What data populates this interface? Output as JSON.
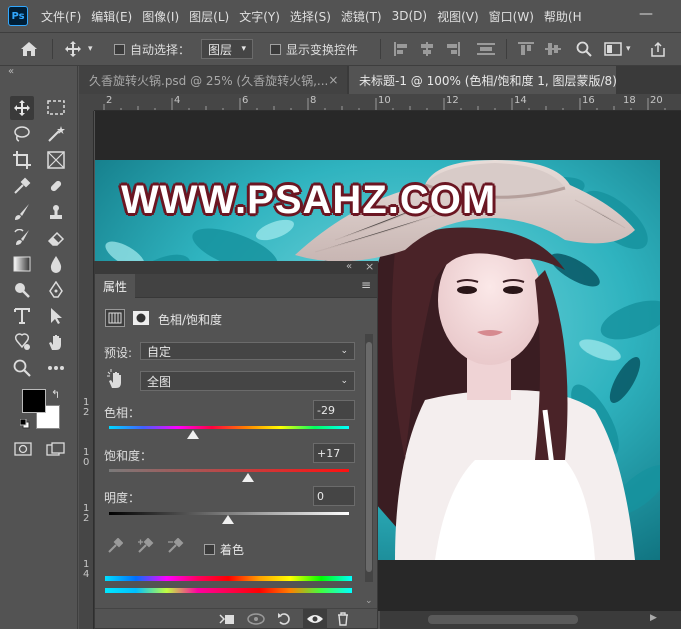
{
  "app": {
    "logo": "Ps"
  },
  "menu": [
    "文件(F)",
    "编辑(E)",
    "图像(I)",
    "图层(L)",
    "文字(Y)",
    "选择(S)",
    "滤镜(T)",
    "3D(D)",
    "视图(V)",
    "窗口(W)",
    "帮助(H"
  ],
  "options": {
    "auto_select_label": "自动选择：",
    "auto_select_target": "图层",
    "show_transform_label": "显示变换控件"
  },
  "tabs": [
    {
      "label": "久香旋转火锅.psd @ 25% (久香旋转火锅,...",
      "active": false
    },
    {
      "label": "未标题-1 @ 100% (色相/饱和度 1, 图层蒙版/8) *",
      "active": true
    }
  ],
  "ruler_top": [
    "2",
    "4",
    "6",
    "8",
    "10",
    "12",
    "14",
    "16",
    "18",
    "20"
  ],
  "ruler_left": [
    [
      "1",
      "2"
    ],
    [
      "1",
      "4"
    ],
    [
      "1",
      "6"
    ],
    [
      "1",
      "8"
    ],
    [
      "1",
      "0"
    ],
    [
      "1",
      "2"
    ],
    [
      "1",
      "4"
    ]
  ],
  "canvas": {
    "watermark": "WWW.PSAHZ.COM"
  },
  "properties": {
    "panel_title": "属性",
    "adjustment_name": "色相/饱和度",
    "preset_label": "预设:",
    "preset_value": "自定",
    "channel_value": "全图",
    "hue_label": "色相：",
    "hue_value": "-29",
    "saturation_label": "饱和度：",
    "saturation_value": "+17",
    "lightness_label": "明度：",
    "lightness_value": "0",
    "colorize_label": "着色",
    "hue_range": [
      -180,
      180
    ],
    "saturation_range": [
      -100,
      100
    ],
    "lightness_range": [
      -100,
      100
    ]
  },
  "colors": {
    "ui_bg": "#535353",
    "panel_dark": "#424242",
    "teal_background": "#2fb4bf",
    "watermark_outline": "#6b1622"
  }
}
